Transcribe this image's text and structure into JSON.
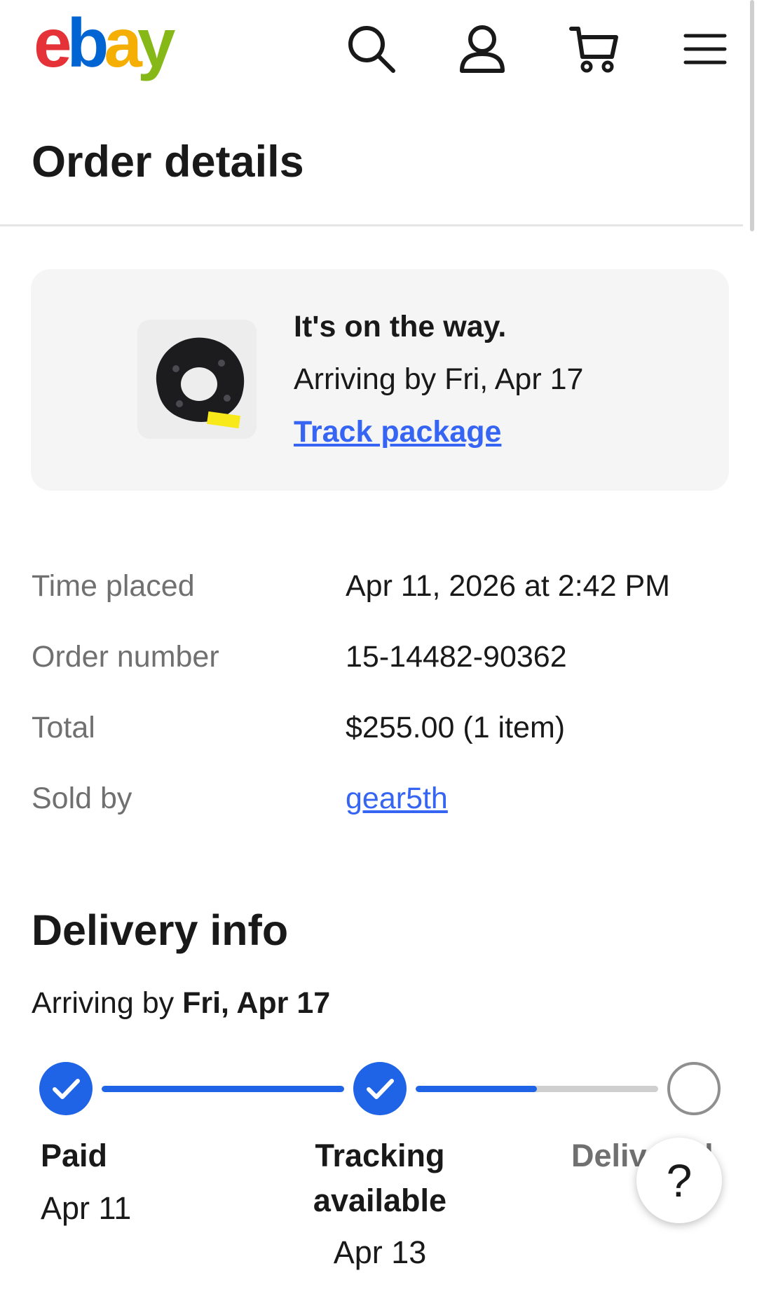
{
  "header": {
    "logo_letters": [
      {
        "char": "e",
        "color": "#e53238"
      },
      {
        "char": "b",
        "color": "#0064d2"
      },
      {
        "char": "a",
        "color": "#f5af02"
      },
      {
        "char": "y",
        "color": "#86b817"
      }
    ],
    "icons": [
      "search-icon",
      "account-icon",
      "cart-icon",
      "menu-icon"
    ]
  },
  "page": {
    "title": "Order details"
  },
  "shipment_card": {
    "status": "It's on the way.",
    "arrival": "Arriving by Fri, Apr 17",
    "track_link": "Track package"
  },
  "order_info": [
    {
      "label": "Time placed",
      "value": "Apr 11, 2026 at 2:42 PM"
    },
    {
      "label": "Order number",
      "value": "15-14482-90362"
    },
    {
      "label": "Total",
      "value": "$255.00 (1 item)"
    },
    {
      "label": "Sold by",
      "value": "gear5th"
    }
  ],
  "delivery": {
    "title": "Delivery info",
    "arriving_prefix": "Arriving by ",
    "arriving_date": "Fri, Apr 17",
    "steps": [
      {
        "label": "Paid",
        "date": "Apr 11",
        "done": true
      },
      {
        "label_line1": "Tracking",
        "label_line2": "available",
        "date": "Apr 13",
        "done": true
      },
      {
        "label": "Delivered",
        "done": false
      }
    ],
    "progress": {
      "segment1": 1.0,
      "segment2": 0.5
    }
  },
  "help": {
    "label": "?"
  },
  "colors": {
    "accent": "#3665f3",
    "progress": "#1f63e6",
    "muted_text": "#707070"
  }
}
